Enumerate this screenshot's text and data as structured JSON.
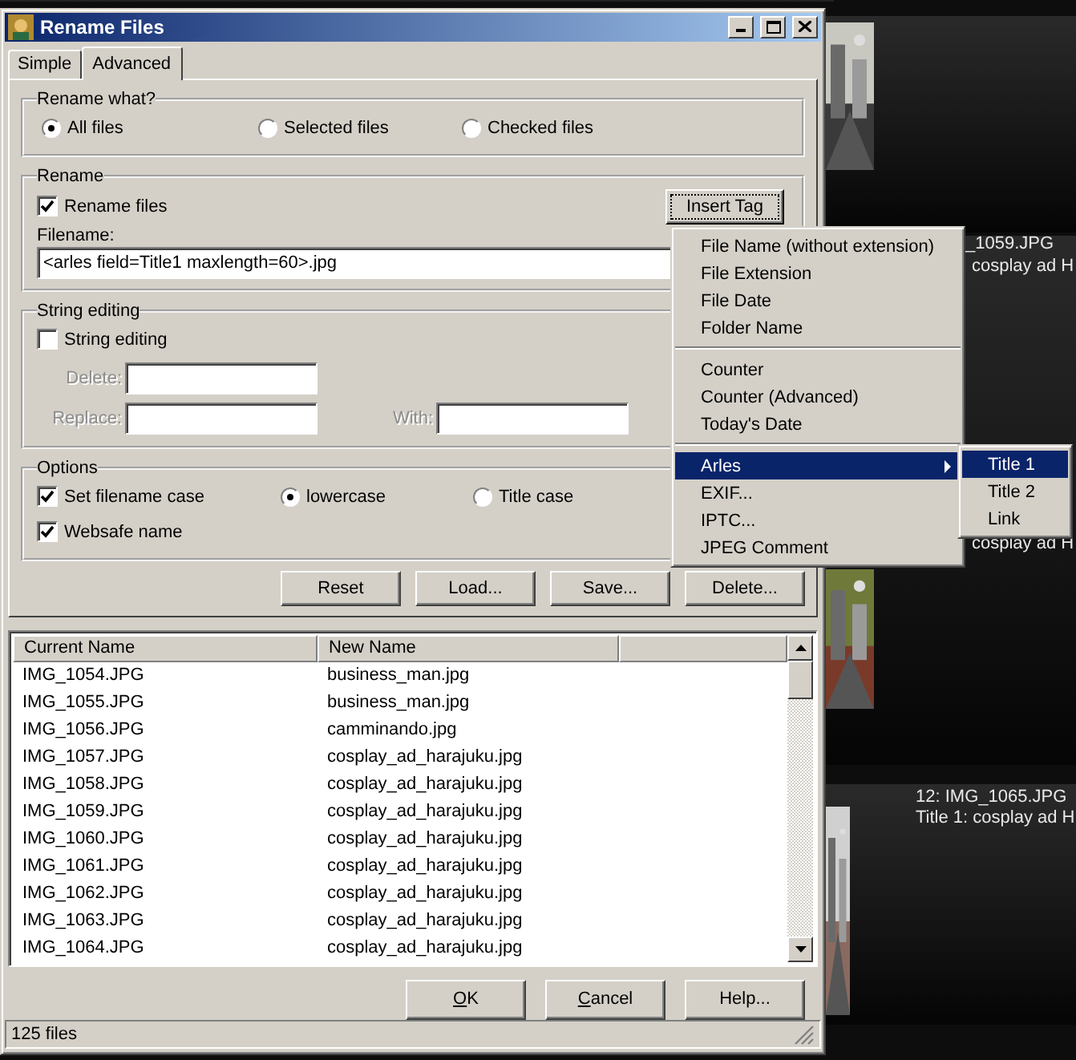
{
  "window": {
    "title": "Rename Files"
  },
  "tabs": [
    {
      "label": "Simple",
      "selected": false
    },
    {
      "label": "Advanced",
      "selected": true
    }
  ],
  "rename_what": {
    "title": "Rename what?",
    "options": [
      {
        "label": "All files",
        "selected": true
      },
      {
        "label": "Selected files",
        "selected": false
      },
      {
        "label": "Checked files",
        "selected": false
      }
    ]
  },
  "rename": {
    "title": "Rename",
    "rename_files": {
      "label": "Rename files",
      "checked": true
    },
    "insert_tag_button": "Insert Tag",
    "filename_label": "Filename:",
    "filename_value": "<arles field=Title1 maxlength=60>.jpg"
  },
  "string_editing": {
    "title": "String editing",
    "checkbox": {
      "label": "String editing",
      "checked": false
    },
    "fields": [
      {
        "label": "Delete:",
        "disabled": true
      },
      {
        "label": "Replace:",
        "disabled": true
      },
      {
        "label": "With:",
        "disabled": true
      }
    ]
  },
  "options": {
    "title": "Options",
    "set_case": {
      "label": "Set filename case",
      "checked": true
    },
    "case_options": [
      {
        "label": "lowercase",
        "selected": true
      },
      {
        "label": "Title case",
        "selected": false
      }
    ],
    "websafe": {
      "label": "Websafe name",
      "checked": true
    }
  },
  "preset_buttons": [
    "Reset",
    "Load...",
    "Save...",
    "Delete..."
  ],
  "table": {
    "columns": [
      "Current Name",
      "New Name"
    ],
    "rows": [
      [
        "IMG_1054.JPG",
        "business_man.jpg"
      ],
      [
        "IMG_1055.JPG",
        "business_man.jpg"
      ],
      [
        "IMG_1056.JPG",
        "camminando.jpg"
      ],
      [
        "IMG_1057.JPG",
        "cosplay_ad_harajuku.jpg"
      ],
      [
        "IMG_1058.JPG",
        "cosplay_ad_harajuku.jpg"
      ],
      [
        "IMG_1059.JPG",
        "cosplay_ad_harajuku.jpg"
      ],
      [
        "IMG_1060.JPG",
        "cosplay_ad_harajuku.jpg"
      ],
      [
        "IMG_1061.JPG",
        "cosplay_ad_harajuku.jpg"
      ],
      [
        "IMG_1062.JPG",
        "cosplay_ad_harajuku.jpg"
      ],
      [
        "IMG_1063.JPG",
        "cosplay_ad_harajuku.jpg"
      ],
      [
        "IMG_1064.JPG",
        "cosplay_ad_harajuku.jpg"
      ]
    ]
  },
  "dialog_buttons": [
    {
      "label": "OK",
      "mnemonic": true
    },
    {
      "label": "Cancel",
      "mnemonic": true
    },
    {
      "label": "Help...",
      "mnemonic": false
    }
  ],
  "status_bar": "125 files",
  "insert_tag_menu": {
    "items": [
      {
        "kind": "item",
        "label": "File Name (without extension)"
      },
      {
        "kind": "item",
        "label": "File Extension"
      },
      {
        "kind": "item",
        "label": "File Date"
      },
      {
        "kind": "item",
        "label": "Folder Name"
      },
      {
        "kind": "separator"
      },
      {
        "kind": "item",
        "label": "Counter"
      },
      {
        "kind": "item",
        "label": "Counter (Advanced)"
      },
      {
        "kind": "item",
        "label": "Today's Date"
      },
      {
        "kind": "separator"
      },
      {
        "kind": "submenu",
        "label": "Arles",
        "selected": true
      },
      {
        "kind": "item",
        "label": "EXIF..."
      },
      {
        "kind": "item",
        "label": "IPTC..."
      },
      {
        "kind": "item",
        "label": "JPEG Comment"
      }
    ],
    "submenu": [
      {
        "label": "Title 1",
        "selected": true
      },
      {
        "label": "Title 2",
        "selected": false
      },
      {
        "label": "Link",
        "selected": false
      }
    ]
  },
  "gallery": {
    "captions": [
      "_1059.JPG",
      "cosplay ad H",
      "cosplay ad H",
      "12: IMG_1065.JPG",
      "Title 1: cosplay ad H"
    ]
  }
}
